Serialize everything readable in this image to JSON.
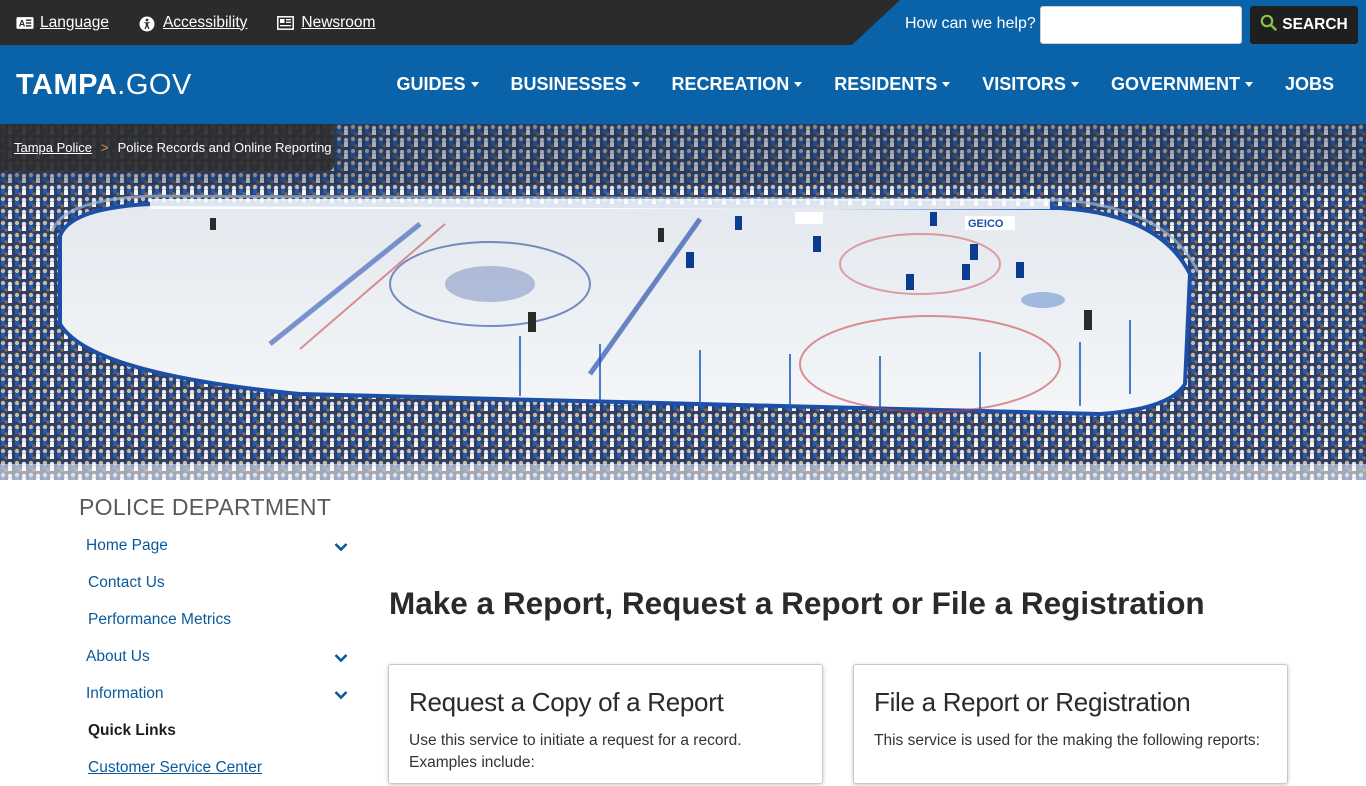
{
  "colors": {
    "brand_blue": "#0a63a9",
    "utility_bg": "#2b2b2b",
    "link_blue": "#0a5a9a",
    "search_btn": "#1f1f1f"
  },
  "utility": {
    "links": [
      {
        "label": "Language",
        "icon": "language-icon"
      },
      {
        "label": "Accessibility",
        "icon": "accessibility-icon"
      },
      {
        "label": "Newsroom",
        "icon": "newspaper-icon"
      }
    ],
    "help_label": "How can we help?",
    "search_value": "",
    "search_button": "SEARCH"
  },
  "nav": {
    "logo_bold": "TAMPA",
    "logo_light": ".GOV",
    "items": [
      "GUIDES",
      "BUSINESSES",
      "RECREATION",
      "RESIDENTS",
      "VISITORS",
      "GOVERNMENT",
      "JOBS"
    ]
  },
  "breadcrumb": {
    "parent": "Tampa Police",
    "separator": ">",
    "current": "Police Records and Online Reporting"
  },
  "sidebar": {
    "title": "POLICE DEPARTMENT",
    "items": [
      {
        "label": "Home Page"
      },
      {
        "label": "Contact Us"
      },
      {
        "label": "Performance Metrics"
      },
      {
        "label": "About Us"
      },
      {
        "label": "Information"
      },
      {
        "label": "Quick Links"
      },
      {
        "label": "Customer Service Center"
      }
    ]
  },
  "main": {
    "title": "Make a Report, Request a Report or File a Registration",
    "cards": [
      {
        "title": "Request a Copy of a Report",
        "text": "Use this service to initiate a request for a record. Examples include:"
      },
      {
        "title": "File a Report or Registration",
        "text": "This service is used for the making the following reports:"
      }
    ]
  }
}
